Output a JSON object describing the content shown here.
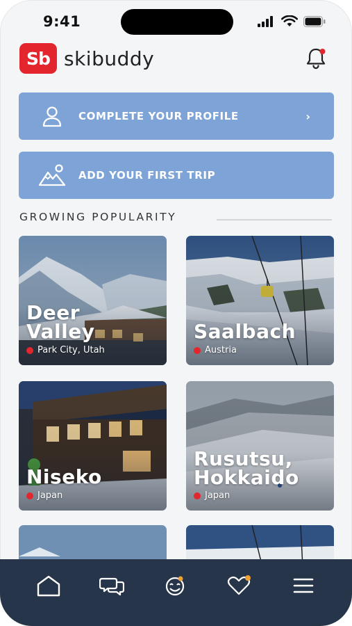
{
  "status": {
    "time": "9:41"
  },
  "app": {
    "name": "skibuddy",
    "logo_mark": "Sb"
  },
  "cta": {
    "profile": {
      "label": "COMPLETE YOUR PROFILE",
      "chevron": "›",
      "icon": "person-icon"
    },
    "trip": {
      "label": "ADD YOUR FIRST TRIP",
      "icon": "mountain-icon"
    }
  },
  "section": {
    "title": "GROWING POPULARITY"
  },
  "resorts": [
    {
      "name_line1": "Deer",
      "name_line2": "Valley",
      "location": "Park City, Utah"
    },
    {
      "name_line1": "Saalbach",
      "name_line2": "",
      "location": "Austria"
    },
    {
      "name_line1": "Niseko",
      "name_line2": "",
      "location": "Japan"
    },
    {
      "name_line1": "Rusutsu,",
      "name_line2": "Hokkaido",
      "location": "Japan"
    }
  ],
  "tabs": [
    {
      "icon": "home-icon"
    },
    {
      "icon": "chat-icon"
    },
    {
      "icon": "buddies-icon"
    },
    {
      "icon": "favorites-icon"
    },
    {
      "icon": "menu-icon"
    }
  ],
  "colors": {
    "brand": "#e3262d",
    "cta": "#7ea3d6",
    "tabbar": "#263549",
    "badge": "#f0a23a"
  }
}
